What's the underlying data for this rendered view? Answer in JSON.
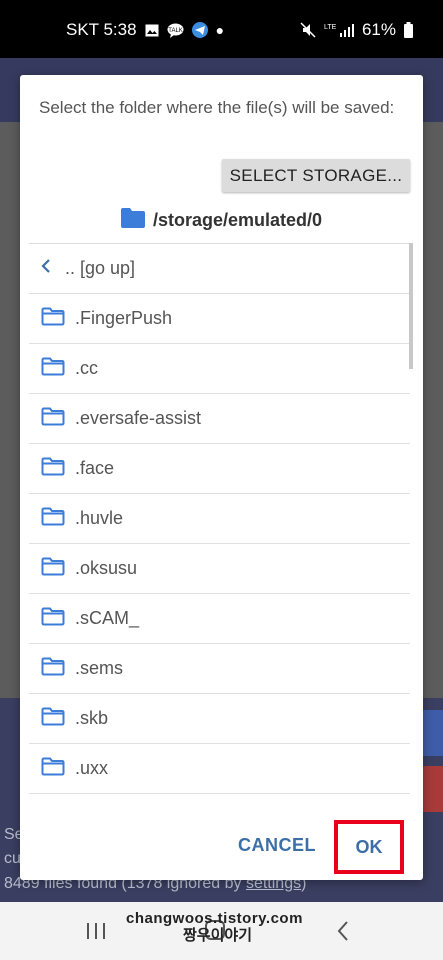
{
  "status_bar": {
    "carrier_time": "SKT 5:38",
    "network": "LTE",
    "battery": "61%"
  },
  "background_app": {
    "line1": "Se",
    "line2": "cu",
    "files_found_prefix": "8489 files found (1378 ignored by ",
    "settings_link": "settings",
    "files_found_suffix": ")"
  },
  "dialog": {
    "message": "Select the folder where the file(s) will be saved:",
    "select_storage_label": "SELECT STORAGE...",
    "current_path": "/storage/emulated/0",
    "go_up_label": ".. [go up]",
    "folders": [
      ".FingerPush",
      ".cc",
      ".eversafe-assist",
      ".face",
      ".huvle",
      ".oksusu",
      ".sCAM_",
      ".sems",
      ".skb",
      ".uxx"
    ],
    "cancel_label": "CANCEL",
    "ok_label": "OK"
  },
  "watermark": {
    "line1": "changwoos.tistory.com",
    "line2": "짱우이야기"
  },
  "colors": {
    "accent": "#3c6ea8",
    "folder_icon": "#3b7dd8",
    "highlight": "#e8001c"
  }
}
